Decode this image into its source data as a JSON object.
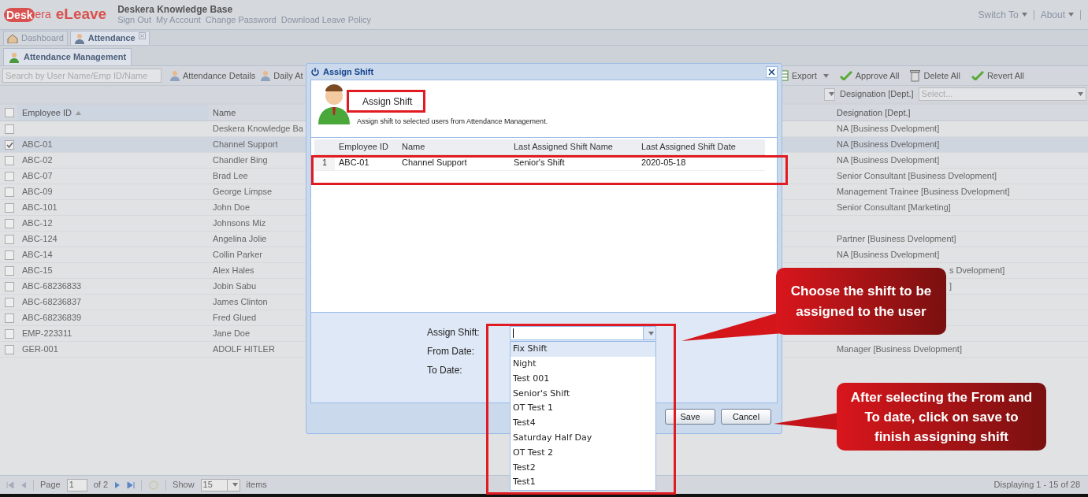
{
  "app": {
    "logo": "Desk",
    "logo_suffix": "era",
    "product": "eLeave",
    "company": "Deskera Knowledge Base",
    "links": [
      "Sign Out",
      "My Account",
      "Change Password",
      "Download Leave Policy"
    ],
    "right_menu": [
      "Switch To",
      "About"
    ]
  },
  "main_tabs": [
    {
      "label": "Dashboard",
      "selected": false,
      "closable": false,
      "kind": "house"
    },
    {
      "label": "Attendance",
      "selected": true,
      "closable": true,
      "kind": "person"
    }
  ],
  "sub_tabs": [
    {
      "label": "Attendance Management",
      "selected": true
    }
  ],
  "toolbar": {
    "search_placeholder": "Search by User Name/Emp ID/Name",
    "left_buttons": [
      "Attendance Details",
      "Daily At"
    ],
    "right_buttons": [
      {
        "label": "Export",
        "kind": "export"
      },
      {
        "label": "Approve All",
        "kind": "check"
      },
      {
        "label": "Delete All",
        "kind": "trash"
      },
      {
        "label": "Revert All",
        "kind": "check"
      }
    ]
  },
  "filter": {
    "label": "Designation [Dept.]",
    "placeholder": "Select..."
  },
  "grid": {
    "select_all_checked": false,
    "columns": [
      "Employee ID",
      "Name",
      "Designation [Dept.]"
    ],
    "rows": [
      {
        "id": "",
        "name": "Deskera Knowledge Ba",
        "designation": "NA [Business Dvelopment]",
        "checked": false,
        "selected": false
      },
      {
        "id": "ABC-01",
        "name": "Channel Support",
        "designation": "NA [Business Dvelopment]",
        "checked": true,
        "selected": true
      },
      {
        "id": "ABC-02",
        "name": "Chandler Bing",
        "designation": "NA [Business Dvelopment]",
        "checked": false,
        "selected": false
      },
      {
        "id": "ABC-07",
        "name": "Brad Lee",
        "designation": "Senior Consultant [Business Dvelopment]",
        "checked": false,
        "selected": false
      },
      {
        "id": "ABC-09",
        "name": "George Limpse",
        "designation": "Management Trainee [Business Dvelopment]",
        "checked": false,
        "selected": false
      },
      {
        "id": "ABC-101",
        "name": "John Doe",
        "designation": "Senior Consultant [Marketing]",
        "checked": false,
        "selected": false
      },
      {
        "id": "ABC-12",
        "name": "Johnsons Miz",
        "checked": false,
        "selected": false
      },
      {
        "id": "ABC-124",
        "name": "Angelina Jolie",
        "designation": "Partner [Business Dvelopment]",
        "checked": false,
        "selected": false
      },
      {
        "id": "ABC-14",
        "name": "Collin Parker",
        "designation": "NA [Business Dvelopment]",
        "checked": false,
        "selected": false
      },
      {
        "id": "ABC-15",
        "name": "Alex Hales",
        "designation": "s Dvelopment]",
        "partly_hidden": true,
        "checked": false,
        "selected": false
      },
      {
        "id": "ABC-68236833",
        "name": "Jobin Sabu",
        "designation": "]",
        "partly_hidden": true,
        "checked": false,
        "selected": false
      },
      {
        "id": "ABC-68236837",
        "name": "James Clinton",
        "checked": false,
        "selected": false
      },
      {
        "id": "ABC-68236839",
        "name": "Fred Glued",
        "checked": false,
        "selected": false
      },
      {
        "id": "EMP-223311",
        "name": "Jane Doe",
        "checked": false,
        "selected": false
      },
      {
        "id": "GER-001",
        "name": "ADOLF HITLER",
        "designation": "Manager [Business Dvelopment]",
        "checked": false,
        "selected": false
      }
    ]
  },
  "paging": {
    "page_label": "Page",
    "page": "1",
    "of": "of 2",
    "show": "Show",
    "page_size": "15",
    "items": "items",
    "summary": "Displaying 1 - 15 of 28"
  },
  "dialog": {
    "title": "Assign Shift",
    "heading": "Assign Shift",
    "description": "Assign shift to selected users from Attendance Management.",
    "columns": [
      "Employee ID",
      "Name",
      "Last Assigned Shift Name",
      "Last Assigned Shift Date"
    ],
    "rows": [
      {
        "number": "1",
        "cells": [
          "ABC-01",
          "Channel Support",
          "Senior's Shift",
          "2020-05-18"
        ]
      }
    ],
    "fields": [
      "Assign Shift:",
      "From Date:",
      "To Date:"
    ],
    "options": [
      {
        "label": "Fix Shift",
        "selected": true
      },
      {
        "label": "Night",
        "selected": false
      },
      {
        "label": "Test 001",
        "selected": false
      },
      {
        "label": "Senior's Shift",
        "selected": false
      },
      {
        "label": "OT Test 1",
        "selected": false
      },
      {
        "label": "Test4",
        "selected": false
      },
      {
        "label": "Saturday Half Day",
        "selected": false
      },
      {
        "label": "OT Test 2",
        "selected": false
      },
      {
        "label": "Test2",
        "selected": false
      },
      {
        "label": "Test1",
        "selected": false
      }
    ],
    "buttons": [
      "Save",
      "Cancel"
    ]
  },
  "callouts": [
    "Choose the shift to be assigned to the user",
    "After selecting the From and To date, click on save to finish  assigning shift"
  ]
}
